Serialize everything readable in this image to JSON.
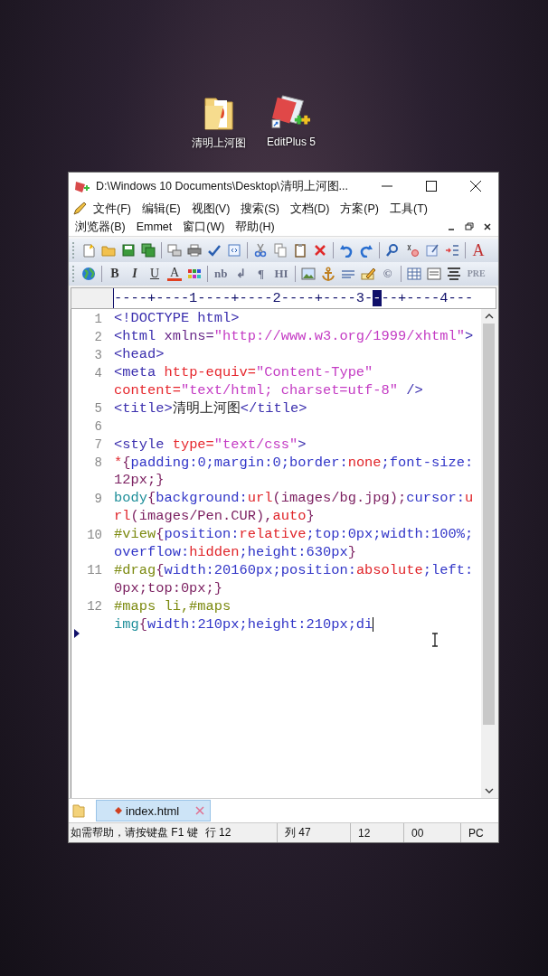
{
  "desktop_icons": [
    {
      "kind": "folder",
      "label": "清明上河图"
    },
    {
      "kind": "editor",
      "label": "EditPlus 5"
    }
  ],
  "window": {
    "title": "D:\\Windows 10 Documents\\Desktop\\清明上河图..."
  },
  "menu_rows": [
    [
      "文件(F)",
      "编辑(E)",
      "视图(V)",
      "搜索(S)",
      "文档(D)",
      "方案(P)",
      "工具(T)"
    ],
    [
      "浏览器(B)",
      "Emmet",
      "窗口(W)",
      "帮助(H)"
    ]
  ],
  "toolbars": [
    {
      "labels": [
        "A"
      ]
    },
    {
      "labels": [
        "B",
        "I",
        "U",
        "A",
        "nb",
        "↲",
        "¶",
        "HI",
        "©",
        "PRE"
      ]
    }
  ],
  "ruler": {
    "before": "----+----1----+----2----+----3-",
    "cursor": "-",
    "after": "--+----4---"
  },
  "code_lines": [
    {
      "number": "1",
      "current": false,
      "rows": [
        {
          "spans": [
            {
              "kind": "tag",
              "text": "<!DOCTYPE html>"
            }
          ]
        }
      ]
    },
    {
      "number": "2",
      "current": false,
      "rows": [
        {
          "spans": [
            {
              "kind": "tag",
              "text": "<html "
            },
            {
              "kind": "name",
              "text": "xmlns="
            },
            {
              "kind": "string",
              "text": "\"http://www.w3.org/1999/xhtml\""
            },
            {
              "kind": "tag",
              "text": ">"
            }
          ]
        }
      ]
    },
    {
      "number": "3",
      "current": false,
      "rows": [
        {
          "spans": [
            {
              "kind": "tag",
              "text": "<head>"
            }
          ]
        }
      ]
    },
    {
      "number": "4",
      "current": false,
      "rows": [
        {
          "spans": [
            {
              "kind": "tag",
              "text": "<meta "
            },
            {
              "kind": "attr",
              "text": "http-equiv="
            },
            {
              "kind": "string",
              "text": "\"Content-Type\""
            }
          ]
        },
        {
          "spans": [
            {
              "kind": "attr",
              "text": "content="
            },
            {
              "kind": "string",
              "text": "\"text/html; charset=utf-8\""
            },
            {
              "kind": "tag",
              "text": " />"
            }
          ]
        }
      ]
    },
    {
      "number": "5",
      "current": false,
      "rows": [
        {
          "spans": [
            {
              "kind": "tag",
              "text": "<title>"
            },
            {
              "kind": "plain",
              "text": "清明上河图"
            },
            {
              "kind": "tag",
              "text": "</title>"
            }
          ]
        }
      ]
    },
    {
      "number": "6",
      "current": false,
      "rows": [
        {
          "spans": []
        }
      ]
    },
    {
      "number": "7",
      "current": false,
      "rows": [
        {
          "spans": [
            {
              "kind": "tag",
              "text": "<style "
            },
            {
              "kind": "attr",
              "text": "type="
            },
            {
              "kind": "string",
              "text": "\"text/css\""
            },
            {
              "kind": "tag",
              "text": ">"
            }
          ]
        }
      ]
    },
    {
      "number": "8",
      "current": false,
      "rows": [
        {
          "spans": [
            {
              "kind": "value",
              "text": "*"
            },
            {
              "kind": "brace",
              "text": "{"
            },
            {
              "kind": "prop",
              "text": "padding:0;margin:0;border:"
            },
            {
              "kind": "value",
              "text": "none"
            },
            {
              "kind": "prop",
              "text": ";font-size:"
            }
          ]
        },
        {
          "spans": [
            {
              "kind": "brace",
              "text": "12px;}"
            }
          ]
        }
      ]
    },
    {
      "number": "9",
      "current": false,
      "rows": [
        {
          "spans": [
            {
              "kind": "element",
              "text": "body"
            },
            {
              "kind": "brace",
              "text": "{"
            },
            {
              "kind": "prop",
              "text": "background:"
            },
            {
              "kind": "value",
              "text": "url"
            },
            {
              "kind": "brace",
              "text": "(images/bg.jpg);"
            },
            {
              "kind": "prop",
              "text": "cursor:"
            },
            {
              "kind": "value",
              "text": "u"
            }
          ]
        },
        {
          "spans": [
            {
              "kind": "value",
              "text": "rl"
            },
            {
              "kind": "brace",
              "text": "(images/Pen.CUR),"
            },
            {
              "kind": "value",
              "text": "auto"
            },
            {
              "kind": "brace",
              "text": "}"
            }
          ]
        }
      ]
    },
    {
      "number": "10",
      "current": false,
      "rows": [
        {
          "spans": [
            {
              "kind": "selector",
              "text": "#view"
            },
            {
              "kind": "brace",
              "text": "{"
            },
            {
              "kind": "prop",
              "text": "position:"
            },
            {
              "kind": "value",
              "text": "relative"
            },
            {
              "kind": "prop",
              "text": ";top:0px;width:100%;"
            }
          ]
        },
        {
          "spans": [
            {
              "kind": "prop",
              "text": "overflow:"
            },
            {
              "kind": "value",
              "text": "hidden"
            },
            {
              "kind": "prop",
              "text": ";height:630px"
            },
            {
              "kind": "brace",
              "text": "}"
            }
          ]
        }
      ]
    },
    {
      "number": "11",
      "current": false,
      "rows": [
        {
          "spans": [
            {
              "kind": "selector",
              "text": "#drag"
            },
            {
              "kind": "brace",
              "text": "{"
            },
            {
              "kind": "prop",
              "text": "width:20160px;position:"
            },
            {
              "kind": "value",
              "text": "absolute"
            },
            {
              "kind": "prop",
              "text": ";left:"
            }
          ]
        },
        {
          "spans": [
            {
              "kind": "brace",
              "text": "0px;top:0px;}"
            }
          ]
        }
      ]
    },
    {
      "number": "12",
      "current": true,
      "rows": [
        {
          "spans": [
            {
              "kind": "selector",
              "text": "#maps li,#maps"
            }
          ]
        },
        {
          "spans": [
            {
              "kind": "element",
              "text": "img"
            },
            {
              "kind": "brace",
              "text": "{"
            },
            {
              "kind": "prop",
              "text": "width:210px;height:210px;di"
            }
          ]
        }
      ]
    }
  ],
  "tabs": [
    {
      "label": "index.html",
      "selected": true
    }
  ],
  "status_bar": {
    "help": "如需帮助，请按键盘 F1 键",
    "cells": [
      "行 12",
      "列 47",
      "12",
      "00",
      "PC"
    ]
  }
}
